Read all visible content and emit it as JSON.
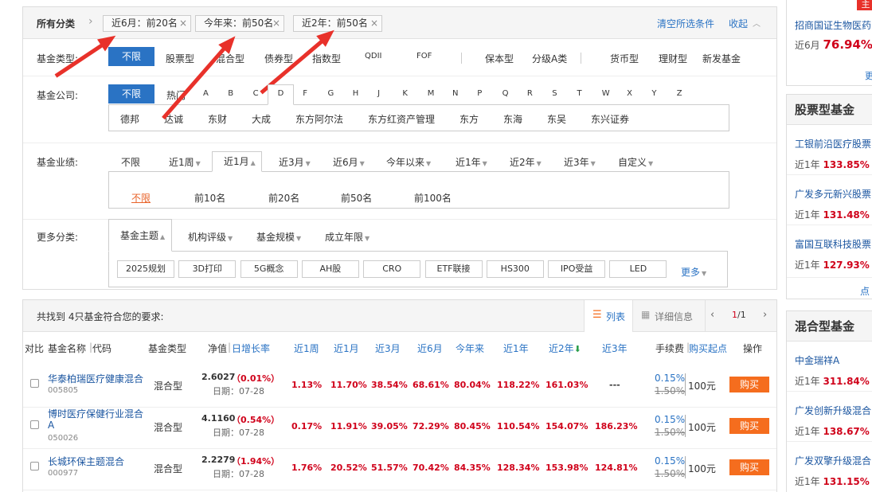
{
  "filter": {
    "all_category": "所有分类",
    "chevron": "›",
    "tags": [
      "近6月：前20名",
      "今年来：前50名",
      "近2年：前50名"
    ],
    "clear_all": "清空所选条件",
    "collapse": "收起",
    "fund_type_label": "基金类型:",
    "fund_types": [
      "不限",
      "股票型",
      "混合型",
      "债券型",
      "指数型",
      "QDII",
      "FOF",
      "保本型",
      "分级A类",
      "货币型",
      "理财型",
      "新发基金"
    ],
    "company_label": "基金公司:",
    "company_letters": [
      "不限",
      "热门",
      "A",
      "B",
      "C",
      "D",
      "F",
      "G",
      "H",
      "J",
      "K",
      "M",
      "N",
      "P",
      "Q",
      "R",
      "S",
      "T",
      "W",
      "X",
      "Y",
      "Z"
    ],
    "companies": [
      "德邦",
      "达诚",
      "东财",
      "大成",
      "东方阿尔法",
      "东方红资产管理",
      "东方",
      "东海",
      "东吴",
      "东兴证券"
    ],
    "performance_label": "基金业绩:",
    "periods": [
      "不限",
      "近1周",
      "近1月",
      "近3月",
      "近6月",
      "今年以来",
      "近1年",
      "近2年",
      "近3年",
      "自定义"
    ],
    "ranks": [
      "不限",
      "前10名",
      "前20名",
      "前50名",
      "前100名"
    ],
    "more_label": "更多分类:",
    "more_tabs": [
      "基金主题",
      "机构评级",
      "基金规模",
      "成立年限"
    ],
    "themes": [
      "2025规划",
      "3D打印",
      "5G概念",
      "AH股",
      "CRO",
      "ETF联接",
      "HS300",
      "IPO受益",
      "LED"
    ],
    "more_link": "更多"
  },
  "results": {
    "summary": "共找到 4只基金符合您的要求:",
    "view_list": "列表",
    "view_detail": "详细信息",
    "page": "1",
    "page_total": "/1",
    "headers": {
      "compare": "对比",
      "name": "基金名称",
      "code": "代码",
      "type": "基金类型",
      "nav": "净值",
      "daily": "日增长率",
      "w1": "近1周",
      "m1": "近1月",
      "m3": "近3月",
      "m6": "近6月",
      "ytd": "今年来",
      "y1": "近1年",
      "y2": "近2年",
      "y3": "近3年",
      "fee": "手续费",
      "min_buy": "购买起点",
      "op": "操作"
    },
    "rows": [
      {
        "name": "华泰柏瑞医疗健康混合",
        "code": "005805",
        "type": "混合型",
        "nav": "2.6027",
        "daily": "（0.01%）",
        "date": "日期：07-28",
        "w1": "1.13%",
        "m1": "11.70%",
        "m3": "38.54%",
        "m6": "68.61%",
        "ytd": "80.04%",
        "y1": "118.22%",
        "y2": "161.03%",
        "y3": "---",
        "fee": "0.15%",
        "fee_orig": "1.50%",
        "min": "100元",
        "buy": "购买"
      },
      {
        "name": "博时医疗保健行业混合A",
        "code": "050026",
        "type": "混合型",
        "nav": "4.1160",
        "daily": "（0.54%）",
        "date": "日期：07-28",
        "w1": "0.17%",
        "m1": "11.91%",
        "m3": "39.05%",
        "m6": "72.29%",
        "ytd": "80.45%",
        "y1": "110.54%",
        "y2": "154.07%",
        "y3": "186.23%",
        "fee": "0.15%",
        "fee_orig": "1.50%",
        "min": "100元",
        "buy": "购买"
      },
      {
        "name": "长城环保主题混合",
        "code": "000977",
        "type": "混合型",
        "nav": "2.2279",
        "daily": "（1.94%）",
        "date": "日期：07-28",
        "w1": "1.76%",
        "m1": "20.52%",
        "m3": "51.57%",
        "m6": "70.42%",
        "ytd": "84.35%",
        "y1": "128.34%",
        "y2": "153.98%",
        "y3": "124.81%",
        "fee": "0.15%",
        "fee_orig": "1.50%",
        "min": "100元",
        "buy": "购买"
      }
    ]
  },
  "sidebar": {
    "top": {
      "corner": "主",
      "name": "招商国证生物医药",
      "label": "近6月",
      "value": "76.94%",
      "link": "更"
    },
    "stock": {
      "title": "股票型基金",
      "items": [
        {
          "name": "工银前沿医疗股票",
          "label": "近1年",
          "value": "133.85%",
          "tail": "手"
        },
        {
          "name": "广发多元新兴股票",
          "label": "近1年",
          "value": "131.48%",
          "tail": "手"
        },
        {
          "name": "富国互联科技股票",
          "label": "近1年",
          "value": "127.93%",
          "tail": "手"
        }
      ],
      "more": "点击"
    },
    "hybrid": {
      "title": "混合型基金",
      "items": [
        {
          "name": "中金瑞祥A",
          "label": "近1年",
          "value": "311.84%",
          "tail": "手"
        },
        {
          "name": "广发创新升级混合",
          "label": "近1年",
          "value": "138.67%",
          "tail": "手"
        },
        {
          "name": "广发双擎升级混合",
          "label": "近1年",
          "value": "131.15%",
          "tail": "手"
        }
      ]
    }
  },
  "colors": {
    "accent": "#2a73c4",
    "red": "#d0021b",
    "buy": "#f56d1e",
    "annotation_arrow": "#e8312a"
  }
}
